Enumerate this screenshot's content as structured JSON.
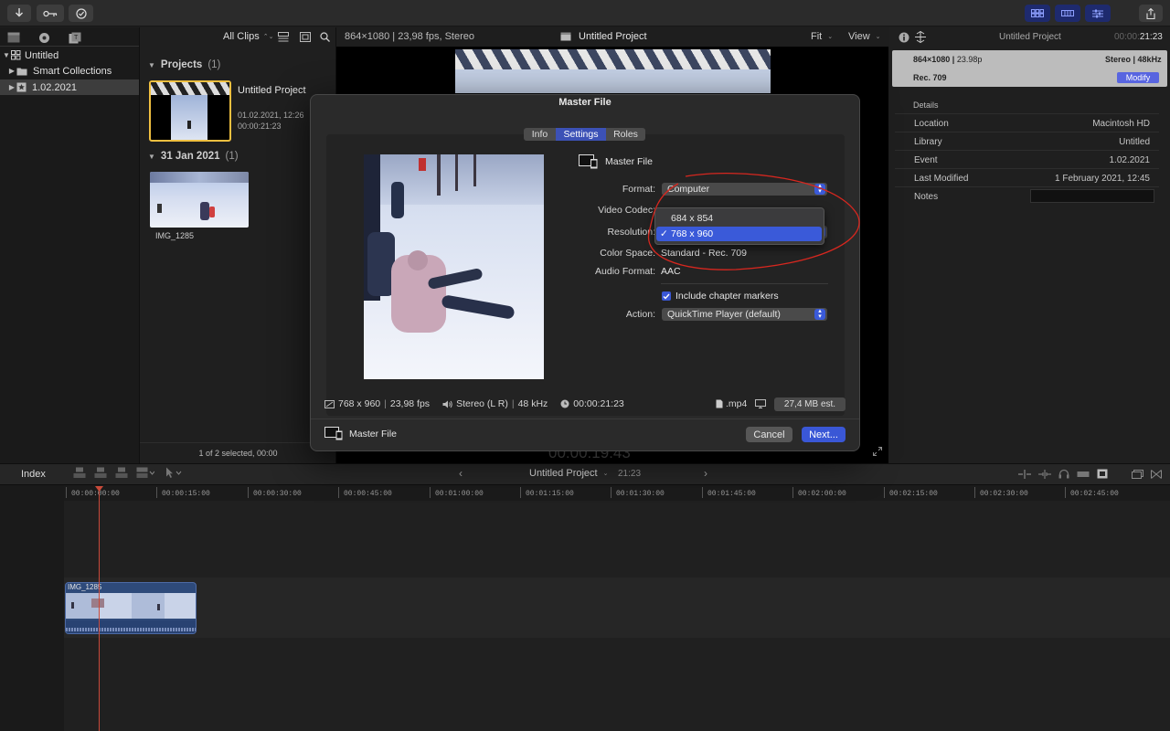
{
  "toolbar": {
    "import_icon": "download-icon",
    "keywords_icon": "key-icon",
    "background_tasks_icon": "checkmark-circle-icon",
    "share_icon": "share-icon"
  },
  "library": {
    "items": [
      {
        "label": "Untitled",
        "level": 0,
        "selected": false
      },
      {
        "label": "Smart Collections",
        "level": 1,
        "selected": false
      },
      {
        "label": "1.02.2021",
        "level": 1,
        "selected": true
      }
    ]
  },
  "browser": {
    "filter": "All Clips",
    "sections": [
      {
        "title": "Projects",
        "count": "(1)"
      },
      {
        "title": "31 Jan 2021",
        "count": "(1)"
      }
    ],
    "project": {
      "name": "Untitled Project",
      "date": "01.02.2021, 12:26",
      "duration": "00:00:21:23"
    },
    "clip": {
      "name": "IMG_1285"
    },
    "status": "1 of 2 selected, 00:00"
  },
  "viewer": {
    "format_info": "864×1080 | 23,98 fps, Stereo",
    "title": "Untitled Project",
    "fit": "Fit",
    "view": "View",
    "timecode": "00:00:19:43"
  },
  "inspector": {
    "title": "Untitled Project",
    "duration_dim": "00:00:",
    "duration": "21:23",
    "format": "864×1080",
    "rate": "23.98p",
    "audio": "Stereo",
    "sample": "48kHz",
    "colorspace": "Rec. 709",
    "modify": "Modify",
    "section": "Details",
    "rows": [
      {
        "label": "Location",
        "value": "Macintosh HD"
      },
      {
        "label": "Library",
        "value": "Untitled"
      },
      {
        "label": "Event",
        "value": "1.02.2021"
      },
      {
        "label": "Last Modified",
        "value": "1 February 2021, 12:45"
      },
      {
        "label": "Notes",
        "value": ""
      }
    ]
  },
  "timeline": {
    "index": "Index",
    "project": "Untitled Project",
    "duration": "21:23",
    "ticks": [
      "00:00:00:00",
      "00:00:15:00",
      "00:00:30:00",
      "00:00:45:00",
      "00:01:00:00",
      "00:01:15:00",
      "00:01:30:00",
      "00:01:45:00",
      "00:02:00:00",
      "00:02:15:00",
      "00:02:30:00",
      "00:02:45:00"
    ],
    "clip_label": "IMG_1285"
  },
  "dialog": {
    "title": "Master File",
    "tabs": [
      "Info",
      "Settings",
      "Roles"
    ],
    "active_tab": "Settings",
    "destination_name": "Master File",
    "fields": {
      "format_label": "Format:",
      "format_value": "Computer",
      "codec_label": "Video Codec:",
      "resolution_label": "Resolution:",
      "colorspace_label": "Color Space:",
      "colorspace_value": "Standard - Rec. 709",
      "audio_label": "Audio Format:",
      "audio_value": "AAC",
      "chapter_label": "Include chapter markers",
      "chapter_checked": true,
      "action_label": "Action:",
      "action_value": "QuickTime Player (default)"
    },
    "resolution_options": [
      "684 x 854",
      "768 x 960"
    ],
    "resolution_selected": "768 x 960",
    "summary": {
      "resolution": "768 x 960",
      "fps": "23,98 fps",
      "audio": "Stereo (L R)",
      "sample": "48 kHz",
      "duration": "00:00:21:23",
      "ext": ".mp4",
      "size": "27,4 MB est."
    },
    "footer_name": "Master File",
    "cancel": "Cancel",
    "next": "Next..."
  },
  "colors": {
    "accent": "#3a57d6",
    "annotation": "#d7271f",
    "selection": "#f0c040"
  }
}
